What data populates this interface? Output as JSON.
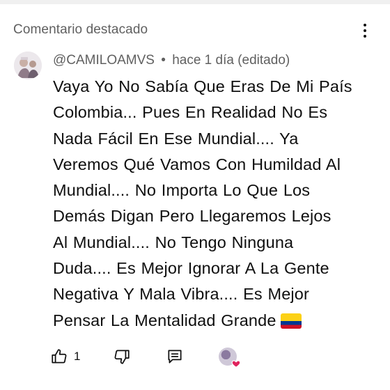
{
  "header": {
    "title": "Comentario destacado",
    "more_icon": "more-vertical-icon"
  },
  "comment": {
    "author": "@CAMILOAMVS",
    "separator": "•",
    "time": "hace 1 día (editado)",
    "lines": [
      "Vaya Yo No Sabía Que Eras De Mi País",
      "Colombia... Pues En Realidad No Es",
      "Nada Fácil En Ese Mundial.... Ya",
      "Veremos Qué Vamos Con Humildad Al",
      "Mundial.... No Importa Lo Que Los",
      "Demás Digan Pero Llegaremos Lejos",
      "Al Mundial.... No Tengo Ninguna",
      "Duda.... Es Mejor Ignorar A La Gente",
      "Negativa Y Mala Vibra.... Es Mejor",
      "Pensar La Mentalidad Grande"
    ],
    "flag": "colombia-flag-icon"
  },
  "actions": {
    "like_count": "1",
    "like_icon": "thumbs-up-icon",
    "dislike_icon": "thumbs-down-icon",
    "reply_icon": "reply-icon",
    "creator_heart_icon": "creator-heart-icon"
  },
  "colors": {
    "text": "#0f0f0f",
    "secondary": "#606060",
    "heart": "#e0245e",
    "flag_yellow": "#fcd116",
    "flag_blue": "#003893",
    "flag_red": "#ce1126"
  }
}
